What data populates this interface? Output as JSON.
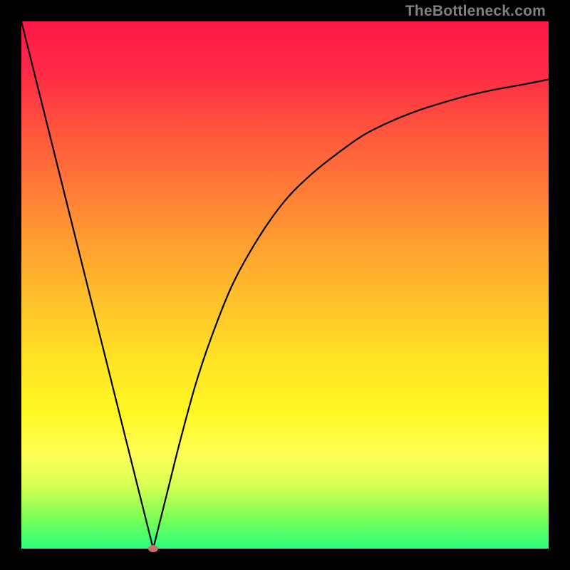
{
  "watermark": "TheBottleneck.com",
  "chart_data": {
    "type": "line",
    "title": "",
    "xlabel": "",
    "ylabel": "",
    "xlim": [
      0,
      100
    ],
    "ylim": [
      0,
      100
    ],
    "grid": false,
    "legend": false,
    "colors": {
      "curve": "#000000",
      "marker": "#cd6f6a"
    },
    "background": "vertical-gradient-red-to-green",
    "x": [
      0,
      5,
      10,
      15,
      20,
      22,
      24,
      25,
      26,
      28,
      30,
      33,
      36,
      40,
      45,
      50,
      55,
      60,
      65,
      70,
      75,
      80,
      85,
      90,
      95,
      100
    ],
    "values": [
      100,
      80,
      60,
      40,
      20,
      12,
      4,
      0,
      4,
      12,
      20,
      31,
      40,
      50,
      59,
      66,
      71,
      75,
      78.5,
      81,
      83,
      84.6,
      86,
      87.1,
      88,
      89
    ],
    "minimum": {
      "x": 25,
      "y": 0
    },
    "series": [
      {
        "name": "bottleneck",
        "x_ref": "x",
        "values_ref": "values"
      }
    ]
  }
}
